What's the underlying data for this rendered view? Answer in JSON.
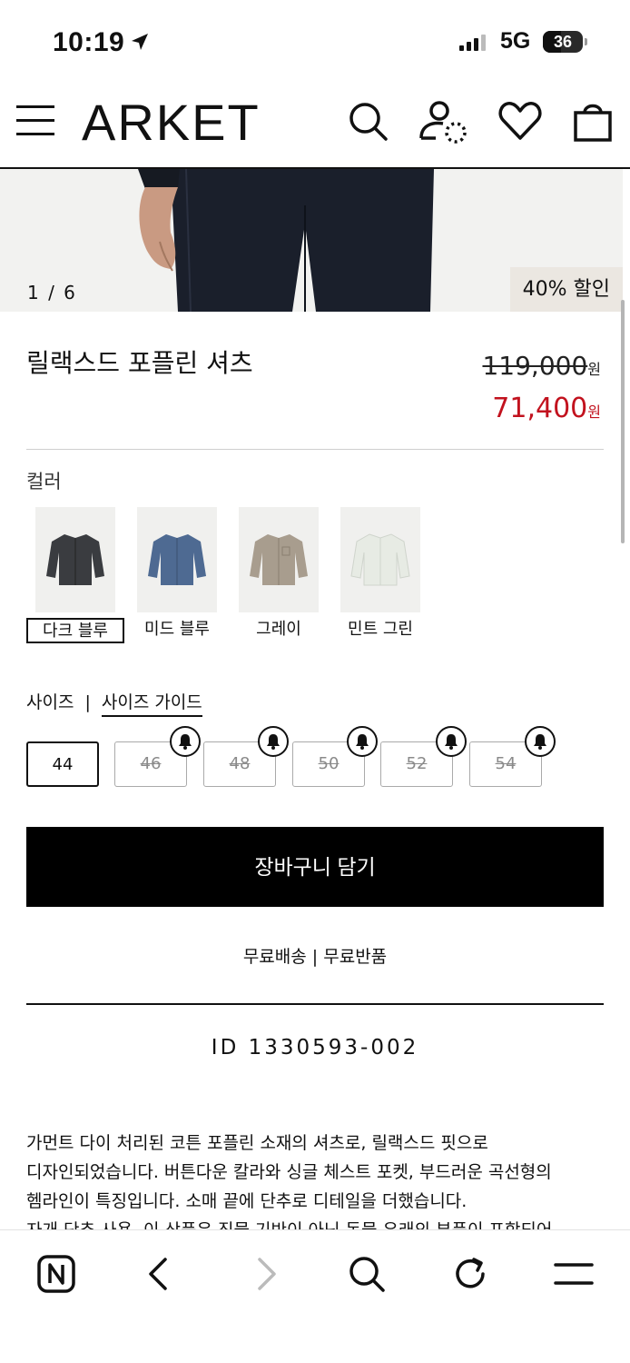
{
  "status_bar": {
    "time": "10:19",
    "network": "5G",
    "battery": "36"
  },
  "header": {
    "logo": "ARKET",
    "icons": [
      "menu-icon",
      "search-icon",
      "account-icon",
      "heart-icon",
      "bag-icon"
    ]
  },
  "hero": {
    "counter": "1 / 6",
    "badge": "40% 할인"
  },
  "product": {
    "title": "릴랙스드 포플린 셔츠",
    "original_price": "119,000",
    "sale_price": "71,400",
    "currency": "원"
  },
  "color": {
    "label": "컬러",
    "options": [
      {
        "label": "다크 블루",
        "color": "#3a3c40",
        "selected": true
      },
      {
        "label": "미드 블루",
        "color": "#4e6a92",
        "selected": false
      },
      {
        "label": "그레이",
        "color": "#a89d8e",
        "selected": false
      },
      {
        "label": "민트 그린",
        "color": "#e7ebe4",
        "selected": false
      }
    ]
  },
  "sizes": {
    "label": "사이즈",
    "separator": "|",
    "guide": "사이즈 가이드",
    "options": [
      {
        "label": "44",
        "available": true
      },
      {
        "label": "46",
        "available": false
      },
      {
        "label": "48",
        "available": false
      },
      {
        "label": "50",
        "available": false
      },
      {
        "label": "52",
        "available": false
      },
      {
        "label": "54",
        "available": false
      }
    ]
  },
  "cart": {
    "button": "장바구니 담기",
    "shipping": "무료배송 | 무료반품"
  },
  "product_id": "ID 1330593-002",
  "description": [
    "가먼트 다이 처리된 코튼 포플린 소재의 셔츠로, 릴랙스드 핏으로",
    "디자인되었습니다. 버튼다운 칼라와 싱글 체스트 포켓, 부드러운 곡선형의",
    "헴라인이 특징입니다. 소매 끝에 단추로 디테일을 더했습니다.",
    "자개 단추 사용. 이 상품은 직물 기반이 아닌 동물 유래의 부품이 포함되어"
  ],
  "colors": {
    "sale": "#c2121e",
    "badge_bg": "#ebe7e1",
    "primary": "#000000"
  }
}
